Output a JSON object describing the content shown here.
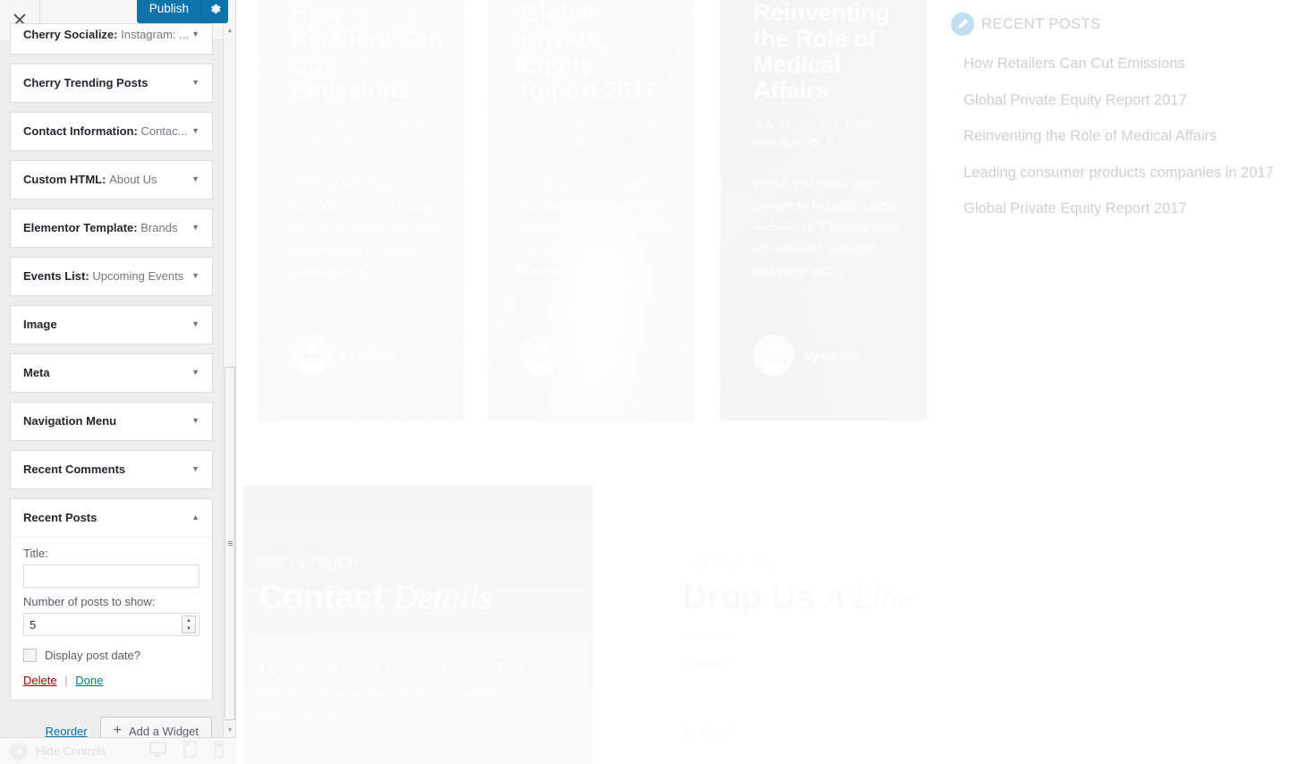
{
  "customizer": {
    "close_label": "×",
    "publish_label": "Publish",
    "gear_icon": "gear-icon",
    "accent_color": "#0d74ab",
    "widgets": [
      {
        "name": "Cherry Socialize:",
        "instance": "Instagram: ...",
        "state": "collapsed",
        "clipped": true
      },
      {
        "name": "Cherry Trending Posts",
        "instance": "",
        "state": "collapsed",
        "clipped": false
      },
      {
        "name": "Contact Information:",
        "instance": "Contac...",
        "state": "collapsed",
        "clipped": false
      },
      {
        "name": "Custom HTML:",
        "instance": "About Us",
        "state": "collapsed",
        "clipped": false
      },
      {
        "name": "Elementor Template:",
        "instance": "Brands",
        "state": "collapsed",
        "clipped": false
      },
      {
        "name": "Events List:",
        "instance": "Upcoming Events",
        "state": "collapsed",
        "clipped": false
      },
      {
        "name": "Image",
        "instance": "",
        "state": "collapsed",
        "clipped": false
      },
      {
        "name": "Meta",
        "instance": "",
        "state": "collapsed",
        "clipped": false
      },
      {
        "name": "Navigation Menu",
        "instance": "",
        "state": "collapsed",
        "clipped": false
      },
      {
        "name": "Recent Comments",
        "instance": "",
        "state": "collapsed",
        "clipped": false
      }
    ],
    "open_widget": {
      "name": "Recent Posts",
      "title_label": "Title:",
      "title_value": "",
      "title_placeholder": "",
      "count_label": "Number of posts to show:",
      "count_value": "5",
      "show_date_label": "Display post date?",
      "show_date_checked": false,
      "delete_label": "Delete",
      "separator": "|",
      "done_label": "Done"
    },
    "actions": {
      "reorder_label": "Reorder",
      "add_widget_label": "Add a Widget",
      "plus_icon": "plus-icon"
    },
    "footer": {
      "hide_controls_label": "Hide Controls",
      "collapse_icon": "collapse-left-icon",
      "devices": [
        {
          "name": "desktop-icon",
          "active": true
        },
        {
          "name": "tablet-icon",
          "active": false
        },
        {
          "name": "mobile-icon",
          "active": false
        }
      ]
    }
  },
  "preview": {
    "posts": [
      {
        "title": "How Retailers Can Cut Emissions",
        "date": "July 12, 2017",
        "category_prefix": "in",
        "category": "Advanced analytics",
        "comments": "0",
        "excerpt": "When you need your company to have a new website or if you venture on updating your old webpage with...",
        "author_prefix": "by",
        "author": "admin"
      },
      {
        "title": "Global Private Equity Report 2017",
        "date": "July 12, 2017",
        "category_prefix": "in",
        "category": "Advanced analytics",
        "comments": "0",
        "excerpt": "When you need your company to have a new website or if you venture on updating your old webpage with...",
        "author_prefix": "by",
        "author": "admin"
      },
      {
        "title": "Reinventing the Role of Medical Affairs",
        "date": "July 12, 2017",
        "category_prefix": "in",
        "category": "Advanced analytics",
        "comments": "0",
        "excerpt": "When you need your company to have a new website or if you venture on updating your old webpage with...",
        "author_prefix": "by",
        "author": "admin"
      }
    ],
    "recent_posts_widget": {
      "heading": "RECENT POSTS",
      "edit_icon": "pencil-edit-icon",
      "edit_icon_color": "#0d86b9",
      "items": [
        "How Retailers Can Cut Emissions",
        "Global Private Equity Report 2017",
        "Reinventing the Role of Medical Affairs",
        "Leading consumer products companies in 2017",
        "Global Private Equity Report 2017"
      ]
    },
    "contact_left": {
      "eyebrow": "GET IN TOUCH",
      "heading_bold": "Contact ",
      "heading_italic": "Details",
      "paragraph": "If you are interested in working with us then please drop us a line, we would love to hear from you."
    },
    "contact_right": {
      "eyebrow": "CONTACT US",
      "heading_bold": "Drop Us ",
      "heading_italic": "A Line",
      "fields": [
        {
          "label": "Name *",
          "value": ""
        },
        {
          "label": "E-mail *",
          "value": ""
        }
      ]
    }
  }
}
